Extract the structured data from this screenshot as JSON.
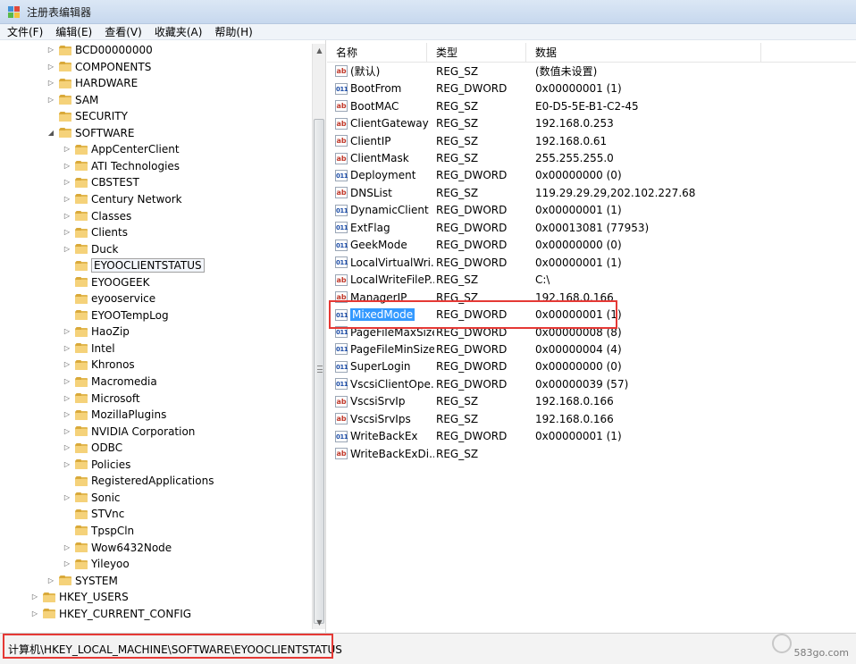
{
  "window": {
    "title": "注册表编辑器"
  },
  "menu": [
    "文件(F)",
    "编辑(E)",
    "查看(V)",
    "收藏夹(A)",
    "帮助(H)"
  ],
  "tree": [
    {
      "label": "BCD00000000",
      "level": 2,
      "expander": "▷"
    },
    {
      "label": "COMPONENTS",
      "level": 2,
      "expander": "▷"
    },
    {
      "label": "HARDWARE",
      "level": 2,
      "expander": "▷"
    },
    {
      "label": "SAM",
      "level": 2,
      "expander": "▷"
    },
    {
      "label": "SECURITY",
      "level": 2,
      "expander": ""
    },
    {
      "label": "SOFTWARE",
      "level": 2,
      "expander": "◢"
    },
    {
      "label": "AppCenterClient",
      "level": 3,
      "expander": "▷"
    },
    {
      "label": "ATI Technologies",
      "level": 3,
      "expander": "▷"
    },
    {
      "label": "CBSTEST",
      "level": 3,
      "expander": "▷"
    },
    {
      "label": "Century Network",
      "level": 3,
      "expander": "▷"
    },
    {
      "label": "Classes",
      "level": 3,
      "expander": "▷"
    },
    {
      "label": "Clients",
      "level": 3,
      "expander": "▷"
    },
    {
      "label": "Duck",
      "level": 3,
      "expander": "▷"
    },
    {
      "label": "EYOOCLIENTSTATUS",
      "level": 3,
      "expander": "",
      "selected": true
    },
    {
      "label": "EYOOGEEK",
      "level": 3,
      "expander": ""
    },
    {
      "label": "eyooservice",
      "level": 3,
      "expander": ""
    },
    {
      "label": "EYOOTempLog",
      "level": 3,
      "expander": ""
    },
    {
      "label": "HaoZip",
      "level": 3,
      "expander": "▷"
    },
    {
      "label": "Intel",
      "level": 3,
      "expander": "▷"
    },
    {
      "label": "Khronos",
      "level": 3,
      "expander": "▷"
    },
    {
      "label": "Macromedia",
      "level": 3,
      "expander": "▷"
    },
    {
      "label": "Microsoft",
      "level": 3,
      "expander": "▷"
    },
    {
      "label": "MozillaPlugins",
      "level": 3,
      "expander": "▷"
    },
    {
      "label": "NVIDIA Corporation",
      "level": 3,
      "expander": "▷"
    },
    {
      "label": "ODBC",
      "level": 3,
      "expander": "▷"
    },
    {
      "label": "Policies",
      "level": 3,
      "expander": "▷"
    },
    {
      "label": "RegisteredApplications",
      "level": 3,
      "expander": ""
    },
    {
      "label": "Sonic",
      "level": 3,
      "expander": "▷"
    },
    {
      "label": "STVnc",
      "level": 3,
      "expander": ""
    },
    {
      "label": "TpspCln",
      "level": 3,
      "expander": ""
    },
    {
      "label": "Wow6432Node",
      "level": 3,
      "expander": "▷"
    },
    {
      "label": "Yileyoo",
      "level": 3,
      "expander": "▷"
    },
    {
      "label": "SYSTEM",
      "level": 2,
      "expander": "▷"
    },
    {
      "label": "HKEY_USERS",
      "level": 1,
      "expander": "▷"
    },
    {
      "label": "HKEY_CURRENT_CONFIG",
      "level": 1,
      "expander": "▷"
    }
  ],
  "columns": {
    "name": "名称",
    "type": "类型",
    "data": "数据"
  },
  "values": [
    {
      "name": "(默认)",
      "type": "REG_SZ",
      "data": "(数值未设置)",
      "icon": "sz"
    },
    {
      "name": "BootFrom",
      "type": "REG_DWORD",
      "data": "0x00000001 (1)",
      "icon": "dword"
    },
    {
      "name": "BootMAC",
      "type": "REG_SZ",
      "data": "E0-D5-5E-B1-C2-45",
      "icon": "sz"
    },
    {
      "name": "ClientGateway",
      "type": "REG_SZ",
      "data": "192.168.0.253",
      "icon": "sz"
    },
    {
      "name": "ClientIP",
      "type": "REG_SZ",
      "data": "192.168.0.61",
      "icon": "sz"
    },
    {
      "name": "ClientMask",
      "type": "REG_SZ",
      "data": "255.255.255.0",
      "icon": "sz"
    },
    {
      "name": "Deployment",
      "type": "REG_DWORD",
      "data": "0x00000000 (0)",
      "icon": "dword"
    },
    {
      "name": "DNSList",
      "type": "REG_SZ",
      "data": "119.29.29.29,202.102.227.68",
      "icon": "sz"
    },
    {
      "name": "DynamicClient",
      "type": "REG_DWORD",
      "data": "0x00000001 (1)",
      "icon": "dword"
    },
    {
      "name": "ExtFlag",
      "type": "REG_DWORD",
      "data": "0x00013081 (77953)",
      "icon": "dword"
    },
    {
      "name": "GeekMode",
      "type": "REG_DWORD",
      "data": "0x00000000 (0)",
      "icon": "dword"
    },
    {
      "name": "LocalVirtualWri...",
      "type": "REG_DWORD",
      "data": "0x00000001 (1)",
      "icon": "dword"
    },
    {
      "name": "LocalWriteFileP...",
      "type": "REG_SZ",
      "data": "C:\\",
      "icon": "sz"
    },
    {
      "name": "ManagerIP",
      "type": "REG_SZ",
      "data": "192.168.0.166",
      "icon": "sz"
    },
    {
      "name": "MixedMode",
      "type": "REG_DWORD",
      "data": "0x00000001 (1)",
      "icon": "dword",
      "selected": true
    },
    {
      "name": "PageFileMaxSize",
      "type": "REG_DWORD",
      "data": "0x00000008 (8)",
      "icon": "dword"
    },
    {
      "name": "PageFileMinSize",
      "type": "REG_DWORD",
      "data": "0x00000004 (4)",
      "icon": "dword"
    },
    {
      "name": "SuperLogin",
      "type": "REG_DWORD",
      "data": "0x00000000 (0)",
      "icon": "dword"
    },
    {
      "name": "VscsiClientOpe...",
      "type": "REG_DWORD",
      "data": "0x00000039 (57)",
      "icon": "dword"
    },
    {
      "name": "VscsiSrvIp",
      "type": "REG_SZ",
      "data": "192.168.0.166",
      "icon": "sz"
    },
    {
      "name": "VscsiSrvIps",
      "type": "REG_SZ",
      "data": "192.168.0.166",
      "icon": "sz"
    },
    {
      "name": "WriteBackEx",
      "type": "REG_DWORD",
      "data": "0x00000001 (1)",
      "icon": "dword"
    },
    {
      "name": "WriteBackExDi...",
      "type": "REG_SZ",
      "data": "",
      "icon": "sz"
    }
  ],
  "status": {
    "path": "计算机\\HKEY_LOCAL_MACHINE\\SOFTWARE\\EYOOCLIENTSTATUS"
  },
  "watermark": {
    "text": "583go.com"
  },
  "colors": {
    "highlight": "#e53935",
    "selection": "#3399ff"
  }
}
